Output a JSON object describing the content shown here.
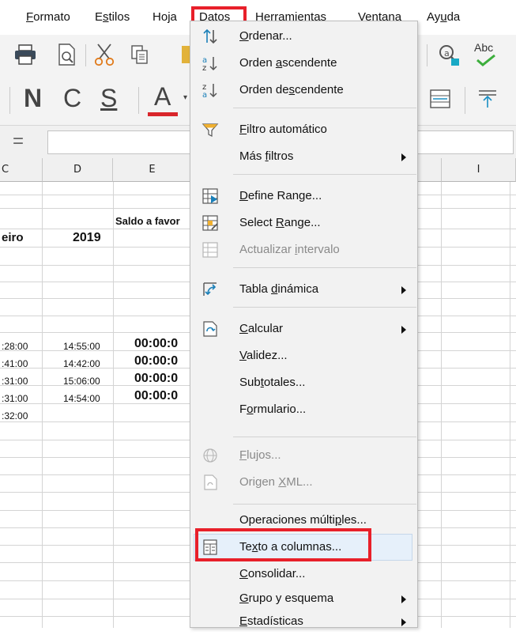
{
  "menubar": {
    "items": [
      {
        "label": "Formato",
        "key": "F",
        "rest": "ormato"
      },
      {
        "label": "Estilos",
        "key": "s",
        "pre": "E",
        "rest": "tilos"
      },
      {
        "label": "Hoja",
        "key": "j",
        "pre": "Ho",
        "rest": "a"
      },
      {
        "label": "Datos",
        "key": "D",
        "rest": "atos"
      },
      {
        "label": "Herramientas",
        "key": "H",
        "rest": "erramientas"
      },
      {
        "label": "Ventana",
        "key": "n",
        "pre": "Ve",
        "rest": "tana"
      },
      {
        "label": "Ayuda",
        "key": "u",
        "pre": "Ay",
        "rest": "da"
      }
    ],
    "active": "Datos"
  },
  "toolbar": {
    "bold": "N",
    "italic": "C",
    "underline": "S",
    "font_color": "A",
    "spell_label": "Abc",
    "font_color_value": "#d9262b"
  },
  "formula_bar": {
    "symbol": "=",
    "value": ""
  },
  "sheet": {
    "columns": [
      "C",
      "D",
      "E",
      "I"
    ],
    "cells": {
      "e3": "Saldo a favor",
      "c4": "eiro",
      "d4": "2019",
      "rows": [
        {
          "c": ":28:00",
          "d": "14:55:00",
          "e": "00:00:0"
        },
        {
          "c": ":41:00",
          "d": "14:42:00",
          "e": "00:00:0"
        },
        {
          "c": ":31:00",
          "d": "15:06:00",
          "e": "00:00:0"
        },
        {
          "c": ":31:00",
          "d": "14:54:00",
          "e": "00:00:0"
        },
        {
          "c": ":32:00",
          "d": "",
          "e": ""
        }
      ]
    }
  },
  "dropdown": {
    "items": [
      {
        "id": "ordenar",
        "a": "",
        "k": "O",
        "b": "rdenar...",
        "icon": "sort-icon",
        "enabled": true
      },
      {
        "id": "orden-asc",
        "a": "Orden ",
        "k": "a",
        "b": "scendente",
        "icon": "sort-ascending-icon",
        "enabled": true
      },
      {
        "id": "orden-desc",
        "a": "Orden de",
        "k": "s",
        "b": "cendente",
        "icon": "sort-descending-icon",
        "enabled": true
      },
      {
        "id": "filtro-auto",
        "a": "",
        "k": "F",
        "b": "iltro automático",
        "icon": "filter-icon",
        "enabled": true
      },
      {
        "id": "mas-filtros",
        "a": "Más ",
        "k": "f",
        "b": "iltros",
        "icon": "",
        "enabled": true,
        "submenu": true
      },
      {
        "id": "define-range",
        "a": "",
        "k": "D",
        "b": "efine Range...",
        "icon": "define-range-icon",
        "enabled": true
      },
      {
        "id": "select-range",
        "a": "Select ",
        "k": "R",
        "b": "ange...",
        "icon": "select-range-icon",
        "enabled": true
      },
      {
        "id": "actualizar-intervalo",
        "a": "Actualizar ",
        "k": "i",
        "b": "ntervalo",
        "icon": "refresh-range-icon",
        "enabled": false
      },
      {
        "id": "tabla-dinamica",
        "a": "Tabla ",
        "k": "d",
        "b": "inámica",
        "icon": "pivot-table-icon",
        "enabled": true,
        "submenu": true
      },
      {
        "id": "calcular",
        "a": "",
        "k": "C",
        "b": "alcular",
        "icon": "calculate-icon",
        "enabled": true,
        "submenu": true
      },
      {
        "id": "validez",
        "a": "",
        "k": "V",
        "b": "alidez...",
        "icon": "",
        "enabled": true
      },
      {
        "id": "subtotales",
        "a": "Sub",
        "k": "t",
        "b": "otales...",
        "icon": "",
        "enabled": true
      },
      {
        "id": "formulario",
        "a": "F",
        "k": "o",
        "b": "rmulario...",
        "icon": "",
        "enabled": true
      },
      {
        "id": "flujos",
        "a": "",
        "k": "F",
        "b": "lujos...",
        "icon": "streams-icon",
        "enabled": false
      },
      {
        "id": "origen-xml",
        "a": "Origen ",
        "k": "X",
        "b": "ML...",
        "icon": "xml-source-icon",
        "enabled": false
      },
      {
        "id": "operaciones-multiples",
        "a": "Operaciones múlti",
        "k": "p",
        "b": "les...",
        "icon": "",
        "enabled": true
      },
      {
        "id": "texto-columnas",
        "a": "Te",
        "k": "x",
        "b": "to a columnas...",
        "icon": "text-to-columns-icon",
        "enabled": true
      },
      {
        "id": "consolidar",
        "a": "",
        "k": "C",
        "b": "onsolidar...",
        "icon": "",
        "enabled": true
      },
      {
        "id": "grupo-esquema",
        "a": "",
        "k": "G",
        "b": "rupo y esquema",
        "icon": "",
        "enabled": true,
        "submenu": true
      },
      {
        "id": "estadisticas",
        "a": "",
        "k": "E",
        "b": "stadísticas",
        "icon": "",
        "enabled": true,
        "submenu": true
      }
    ]
  },
  "colors": {
    "highlight": "#e8202a",
    "menu_bg": "#f2f2f2",
    "hover_bg": "#e5f1fb"
  }
}
